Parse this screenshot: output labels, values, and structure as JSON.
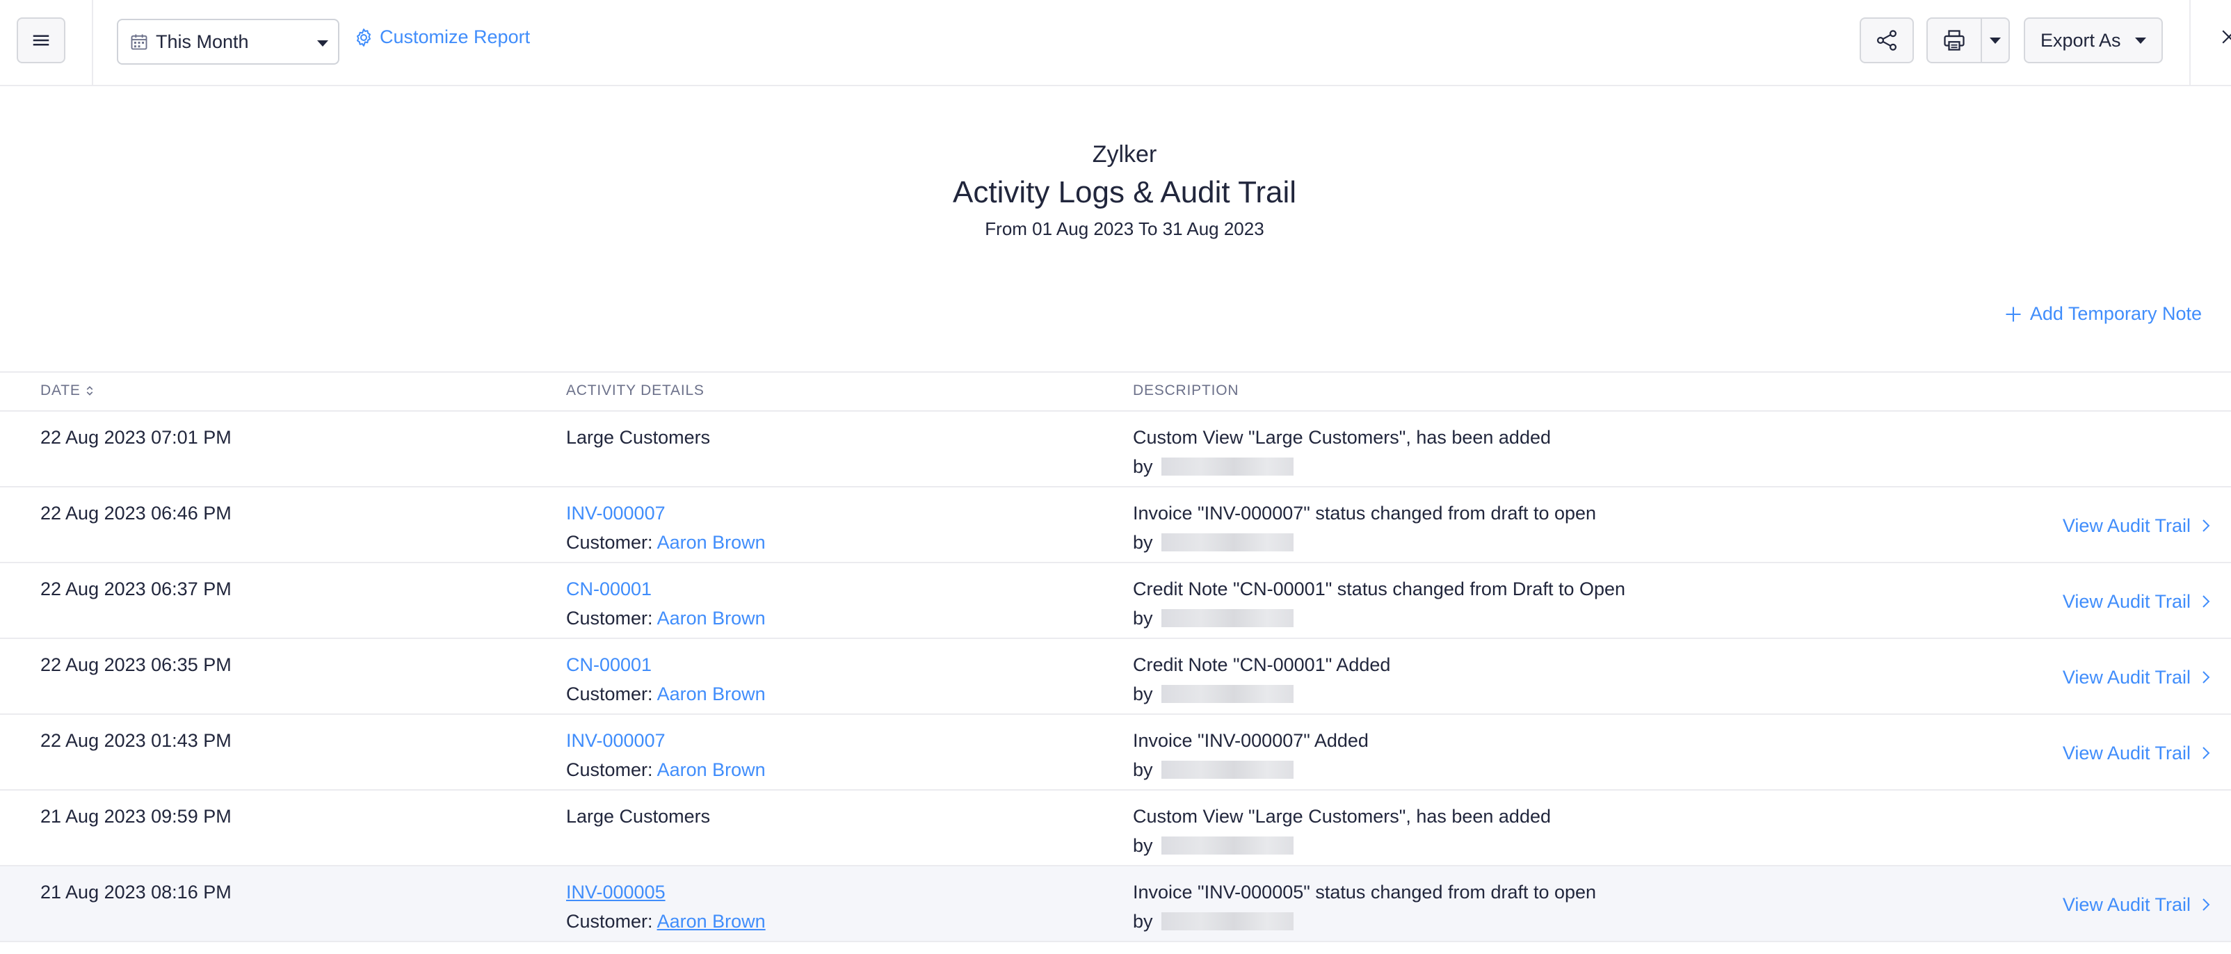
{
  "toolbar": {
    "period": "This Month",
    "customize_label": "Customize Report",
    "export_label": "Export As"
  },
  "icons": {
    "menu": "hamburger-menu-icon",
    "calendar": "calendar-icon",
    "customize": "gear-icon",
    "share": "share-icon",
    "print": "printer-icon",
    "close": "close-icon",
    "add": "plus-icon",
    "sort": "sort-icon",
    "chevron": "chevron-right-icon"
  },
  "colors": {
    "accent": "#408dfb",
    "text": "#21263c",
    "muted": "#6c718a",
    "border": "#ebebef",
    "row_hover": "#f5f6fa"
  },
  "report": {
    "org": "Zylker",
    "title": "Activity Logs & Audit Trail",
    "range": "From 01 Aug 2023 To 31 Aug 2023",
    "add_note": "Add Temporary Note"
  },
  "table": {
    "columns": {
      "date": "DATE",
      "activity": "ACTIVITY DETAILS",
      "description": "DESCRIPTION"
    },
    "audit_label": "View Audit Trail",
    "customer_prefix": "Customer:",
    "by_prefix": "by",
    "rows": [
      {
        "date": "22 Aug 2023 07:01 PM",
        "activity": "Large Customers",
        "customer": "",
        "description": "Custom View \"Large Customers\", has been added"
      },
      {
        "date": "22 Aug 2023 06:46 PM",
        "activity": "INV-000007",
        "customer": "Aaron Brown",
        "description": "Invoice \"INV-000007\" status changed from draft to open"
      },
      {
        "date": "22 Aug 2023 06:37 PM",
        "activity": "CN-00001",
        "customer": "Aaron Brown",
        "description": "Credit Note \"CN-00001\" status changed from Draft to Open"
      },
      {
        "date": "22 Aug 2023 06:35 PM",
        "activity": "CN-00001",
        "customer": "Aaron Brown",
        "description": "Credit Note \"CN-00001\" Added"
      },
      {
        "date": "22 Aug 2023 01:43 PM",
        "activity": "INV-000007",
        "customer": "Aaron Brown",
        "description": "Invoice \"INV-000007\" Added"
      },
      {
        "date": "21 Aug 2023 09:59 PM",
        "activity": "Large Customers",
        "customer": "",
        "description": "Custom View \"Large Customers\", has been added"
      },
      {
        "date": "21 Aug 2023 08:16 PM",
        "activity": "INV-000005",
        "customer": "Aaron Brown",
        "description": "Invoice \"INV-000005\" status changed from draft to open"
      }
    ]
  }
}
